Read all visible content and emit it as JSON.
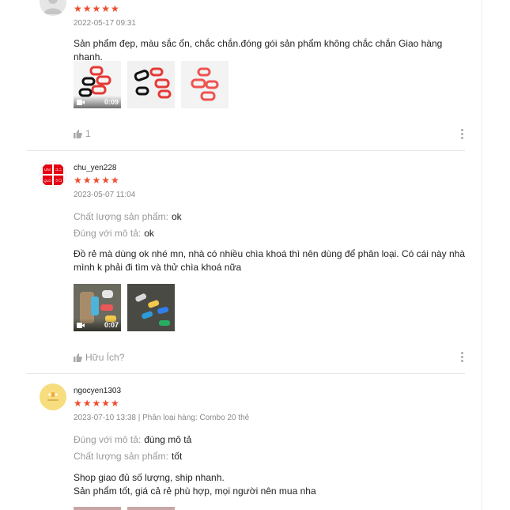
{
  "reviews": [
    {
      "username": "",
      "stars": "★★★★★",
      "meta": "2022-05-17 09:31",
      "text": "Sản phẩm đẹp, màu sắc ổn, chắc chắn.đóng gói sản phẩm không chắc chắn Giao hàng nhanh.",
      "video_duration": "0:09",
      "helpful": "1"
    },
    {
      "username": "chu_yen228",
      "stars": "★★★★★",
      "meta": "2023-05-07 11:04",
      "attrs": [
        {
          "label": "Chất lượng sản phẩm:",
          "value": "ok"
        },
        {
          "label": "Đúng với mô tả:",
          "value": "ok"
        }
      ],
      "text": "Đồ rẻ mà dùng ok nhé mn, nhà có nhiều chìa khoá thì nên dùng để phân loại. Có cái này nhà mình k phải đi tìm và thử chìa khoá nữa",
      "video_duration": "0:07",
      "helpful": "Hữu Ích?",
      "avatar_text": [
        "UNI",
        "QLO",
        "ユニ",
        "クロ"
      ]
    },
    {
      "username": "ngocyen1303",
      "stars": "★★★★★",
      "meta": "2023-07-10 13:38 | Phân loại hàng: Combo 20 thẻ",
      "attrs": [
        {
          "label": "Đúng với mô tả:",
          "value": "đúng mô tả"
        },
        {
          "label": "Chất lượng sản phẩm:",
          "value": "tốt"
        }
      ],
      "text": "Shop giao đủ số lượng, ship nhanh.\nSản phẩm tốt, giá cả rẻ phù hợp, mọi người nên mua nha"
    }
  ],
  "colors": {
    "star": "#ee4d2d",
    "muted": "#999999",
    "text": "#222222"
  },
  "icons": {
    "like": "thumbs-up-icon",
    "video": "video-camera-icon",
    "more": "more-vertical-icon"
  }
}
